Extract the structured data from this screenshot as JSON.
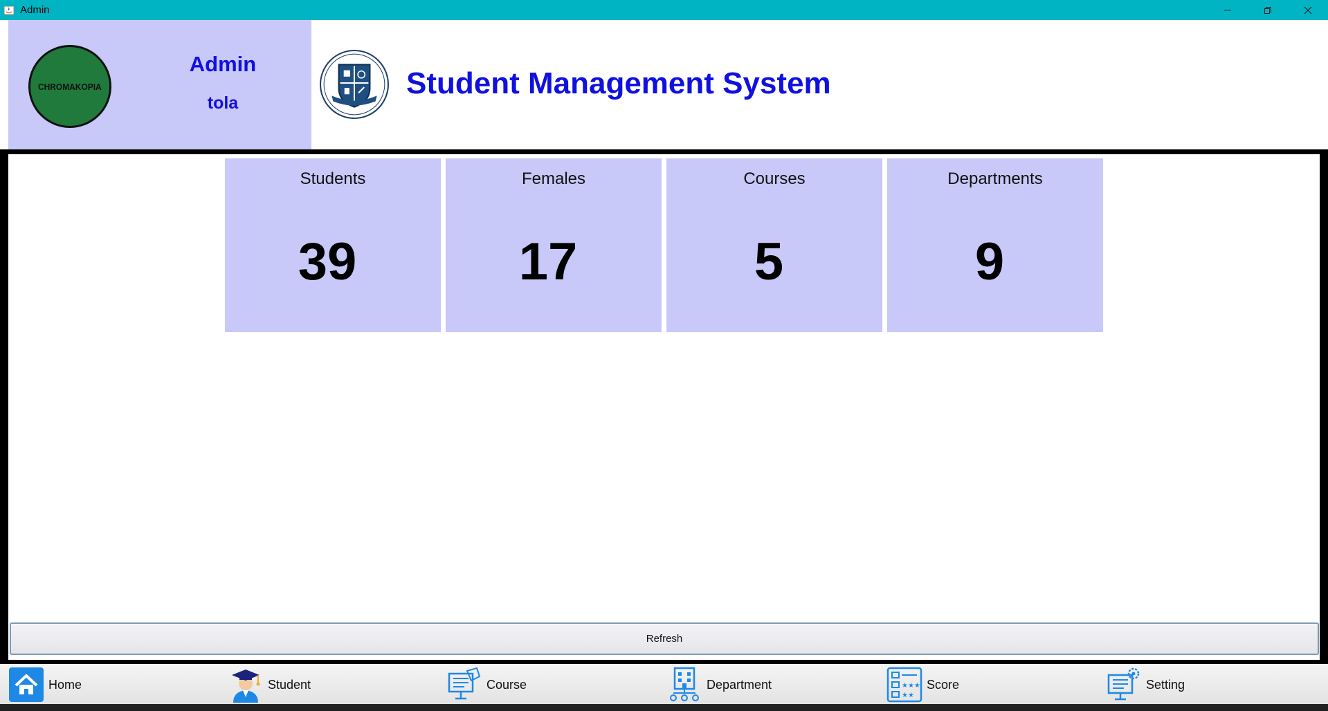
{
  "window": {
    "title": "Admin"
  },
  "profile": {
    "role": "Admin",
    "username": "tola",
    "avatar_text": "CHROMAKOPIA"
  },
  "header": {
    "app_title": "Student Management System"
  },
  "stats": [
    {
      "label": "Students",
      "value": "39"
    },
    {
      "label": "Females",
      "value": "17"
    },
    {
      "label": "Courses",
      "value": "5"
    },
    {
      "label": "Departments",
      "value": "9"
    }
  ],
  "refresh_label": "Refresh",
  "nav": [
    {
      "label": "Home",
      "icon": "home-icon"
    },
    {
      "label": "Student",
      "icon": "student-icon"
    },
    {
      "label": "Course",
      "icon": "course-icon"
    },
    {
      "label": "Department",
      "icon": "department-icon"
    },
    {
      "label": "Score",
      "icon": "score-icon"
    },
    {
      "label": "Setting",
      "icon": "setting-icon"
    }
  ],
  "colors": {
    "titlebar": "#00b4c4",
    "panel": "#c8c8f9",
    "accent_text": "#1010e0",
    "avatar": "#1f7a3c"
  }
}
